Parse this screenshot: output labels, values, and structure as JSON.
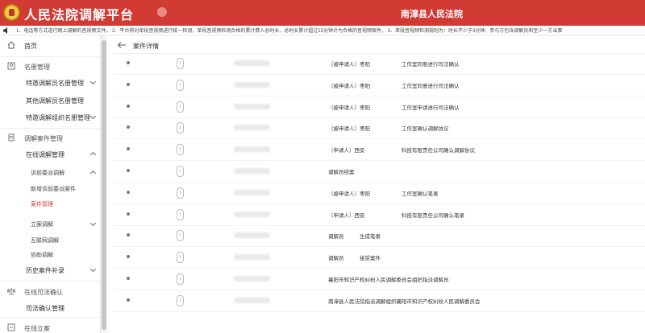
{
  "header": {
    "app_title": "人民法院调解平台",
    "court_name": "南漳县人民法院"
  },
  "notice": {
    "text": "1、电话等方式进行网上调解的音视频文件。 2、平台将对单段音视频进行统一检测，单段音视频检测合格的累计算入总时长，总时长累计超过15分钟计为合格的音视频案件。 3、单段音视频检测规则为：时长不少于3分钟、参与方包含调解员和至少一方当事"
  },
  "sidebar": {
    "items": [
      {
        "label": "首页"
      },
      {
        "label": "名册管理"
      },
      {
        "label": "特邀调解员名册管理"
      },
      {
        "label": "其他调解员名册管理"
      },
      {
        "label": "特邀调解组织名册管理"
      },
      {
        "label": "调解案件管理"
      },
      {
        "label": "在线调解管理"
      },
      {
        "label": "诉前委派调解"
      },
      {
        "label": "新增诉前委派案件"
      },
      {
        "label": "案件管理"
      },
      {
        "label": "立案调解"
      },
      {
        "label": "互联网调解"
      },
      {
        "label": "协助调解"
      },
      {
        "label": "历史案件补录"
      },
      {
        "label": "在线司法确认"
      },
      {
        "label": "司法确认管理"
      },
      {
        "label": "在线立案"
      }
    ]
  },
  "main": {
    "breadcrumb": "案件详情",
    "rows": [
      {
        "desc": "（被申请人）枣阳　　　　　　工作室同意进行司法确认"
      },
      {
        "desc": "（被申请人）枣阳　　　　　　工作室同意进行司法确认"
      },
      {
        "desc": "（被申请人）枣阳　　　　　　工作室申请进行司法确认"
      },
      {
        "desc": "（被申请人）枣阳　　　　　　工作室确认调解协议"
      },
      {
        "desc": "（申请人）西安　　　　　　　科技有限责任公司确认调解协议"
      },
      {
        "desc": "调解员结案"
      },
      {
        "desc": "（被申请人）枣阳　　　　　　工作室确认笔录"
      },
      {
        "desc": "（申请人）西安　　　　　　　科技有限责任公司确认笔录"
      },
      {
        "desc": "调解员　　　生成笔录"
      },
      {
        "desc": "调解员　　　接受案件"
      },
      {
        "desc": "襄阳市知识产权纠纷人民调解委员会组织指派调解员"
      },
      {
        "desc": "南漳县人民法院指派调解组织襄阳市知识产权纠纷人民调解委员会"
      }
    ]
  },
  "colors": {
    "brand_red": "#d23a34",
    "active_text": "#d23a34"
  }
}
